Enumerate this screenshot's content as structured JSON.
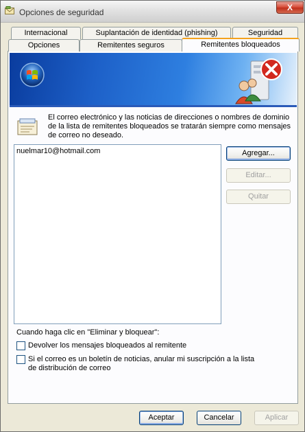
{
  "window": {
    "title": "Opciones de seguridad",
    "close_label": "X"
  },
  "tabs_row_top": [
    {
      "label": "Internacional"
    },
    {
      "label": "Suplantación de identidad (phishing)"
    },
    {
      "label": "Seguridad"
    }
  ],
  "tabs_row_bottom": [
    {
      "label": "Opciones"
    },
    {
      "label": "Remitentes seguros"
    },
    {
      "label": "Remitentes bloqueados",
      "active": true
    }
  ],
  "info": {
    "text": "El correo electrónico y las noticias de direcciones o nombres de dominio de la lista de remitentes bloqueados se tratarán siempre como mensajes de correo no deseado."
  },
  "blocked_list": {
    "items": [
      "nuelmar10@hotmail.com"
    ]
  },
  "side_buttons": {
    "add": "Agregar...",
    "edit": "Editar...",
    "remove": "Quitar"
  },
  "delete_block": {
    "heading": "Cuando haga clic en \"Eliminar y bloquear\":",
    "option1": "Devolver los mensajes bloqueados al remitente",
    "option1_checked": false,
    "option2": "Si el correo es un boletín de noticias, anular mi suscripción a la lista de distribución de correo",
    "option2_checked": false
  },
  "footer": {
    "ok": "Aceptar",
    "cancel": "Cancelar",
    "apply": "Aplicar"
  },
  "colors": {
    "active_tab_accent": "#f4a21c",
    "banner_blue": "#1d60c8",
    "close_red": "#c0301c"
  }
}
